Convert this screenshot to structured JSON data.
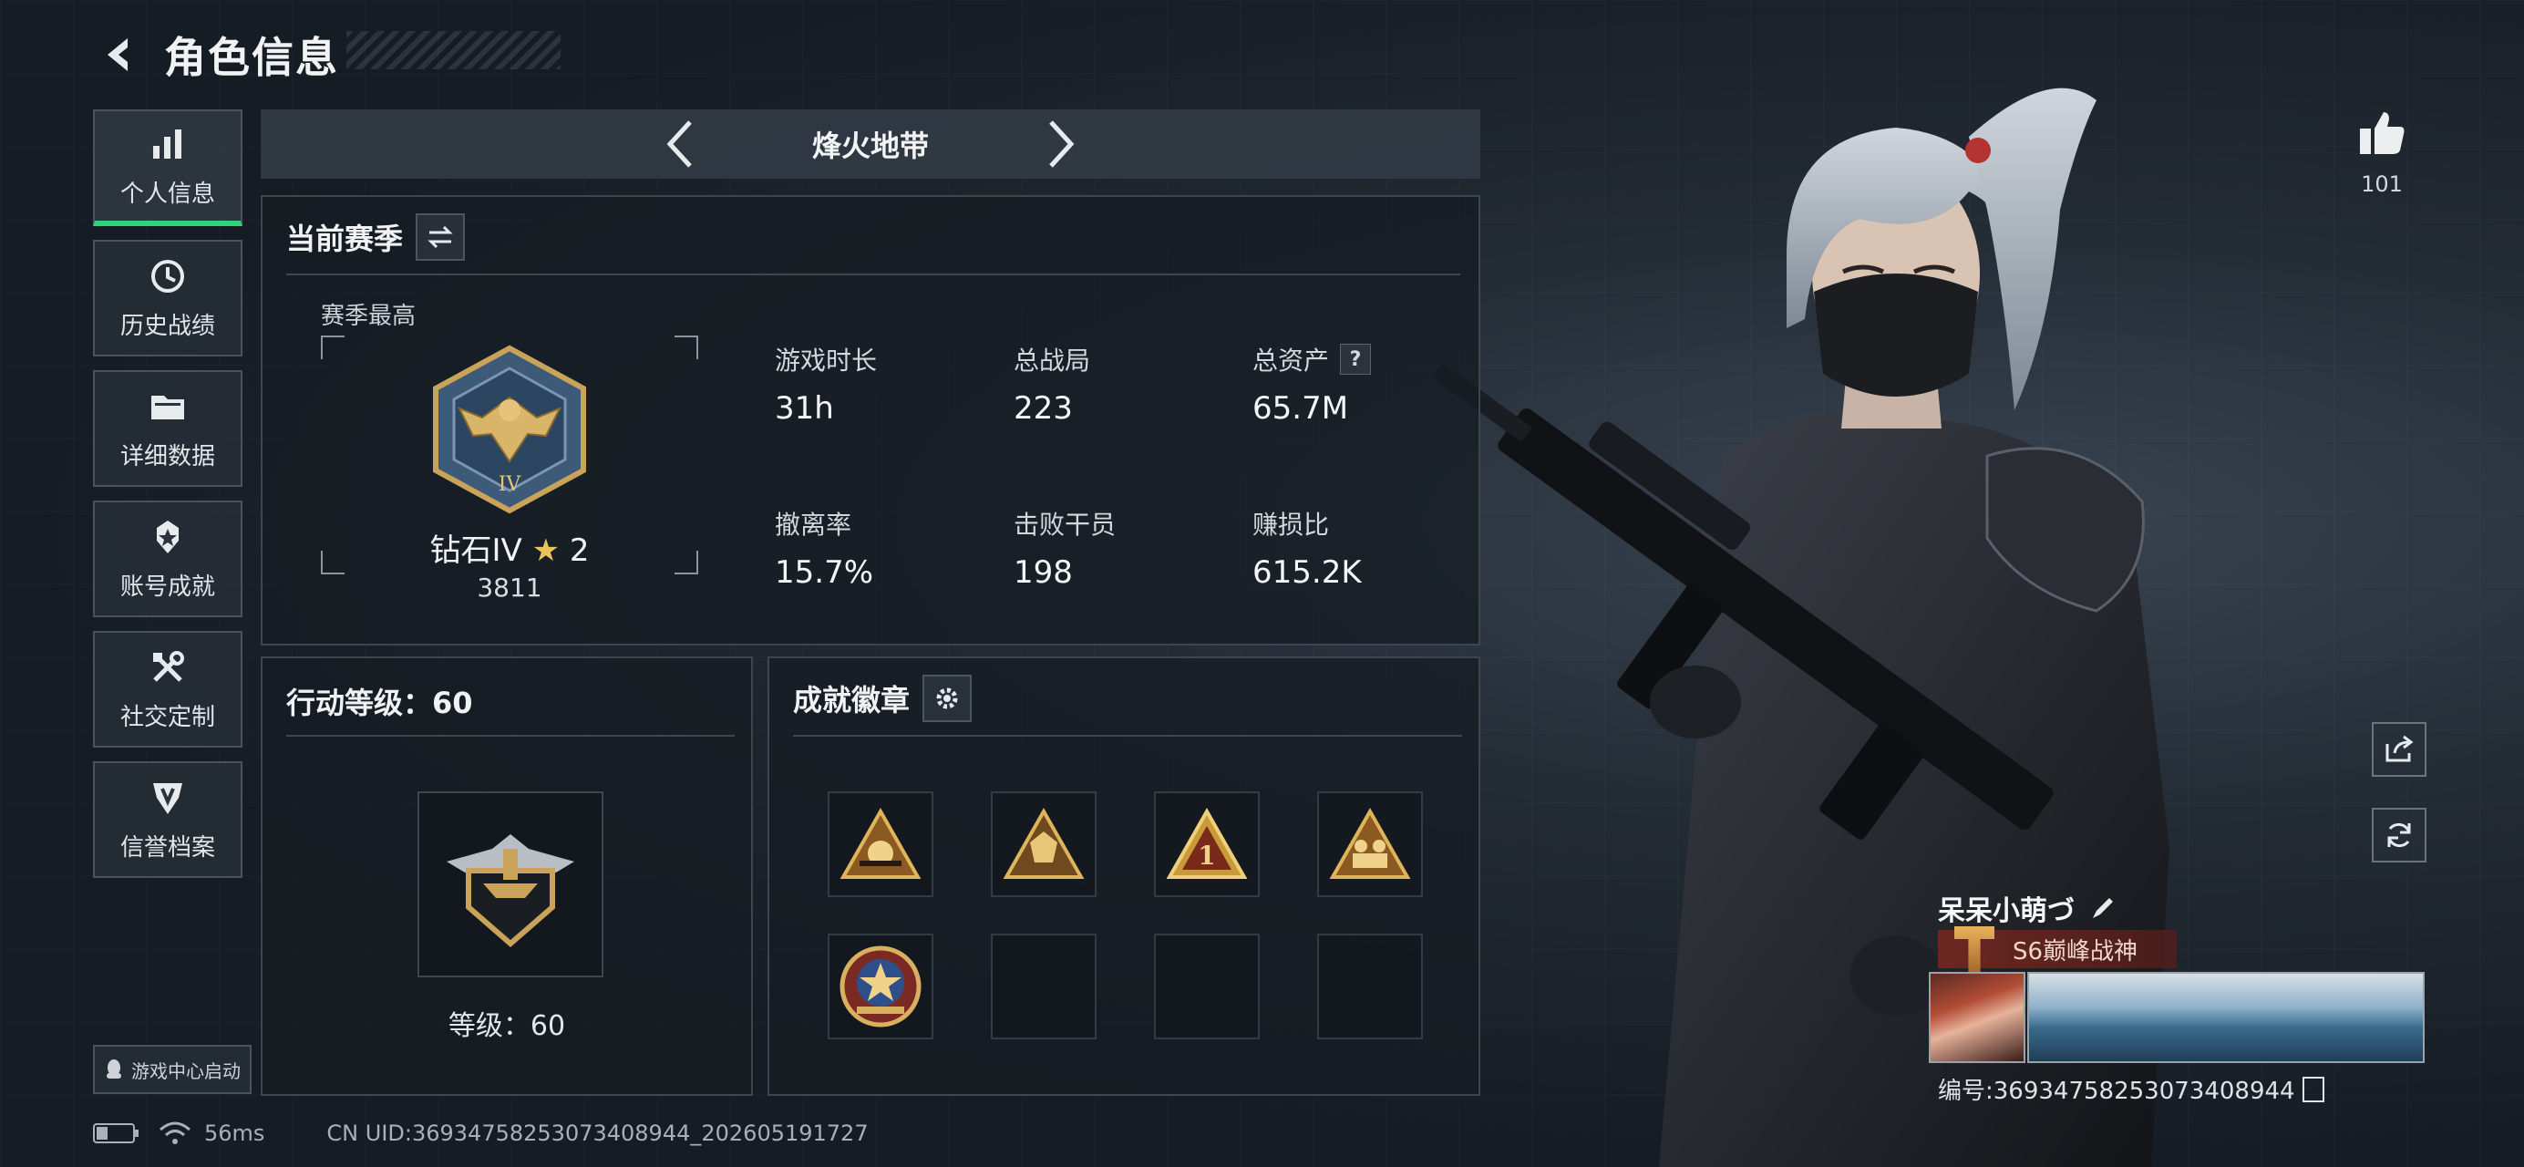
{
  "header": {
    "title": "角色信息"
  },
  "sidebar": {
    "items": [
      {
        "label": "个人信息",
        "icon": "bar-chart-icon",
        "active": true
      },
      {
        "label": "历史战绩",
        "icon": "clock-icon",
        "active": false
      },
      {
        "label": "详细数据",
        "icon": "folder-icon",
        "active": false
      },
      {
        "label": "账号成就",
        "icon": "medal-icon",
        "active": false
      },
      {
        "label": "社交定制",
        "icon": "tools-icon",
        "active": false
      },
      {
        "label": "信誉档案",
        "icon": "shield-icon",
        "active": false
      }
    ],
    "game_center_label": "游戏中心启动"
  },
  "mode": {
    "title": "烽火地带"
  },
  "season": {
    "header": "当前赛季",
    "peak_label": "赛季最高",
    "rank_name": "钻石IV",
    "rank_stars": "2",
    "rank_score": "3811",
    "badge_numeral": "IV"
  },
  "stats": [
    {
      "label": "游戏时长",
      "value": "31h"
    },
    {
      "label": "总战局",
      "value": "223"
    },
    {
      "label": "总资产",
      "value": "65.7M",
      "help": "?"
    },
    {
      "label": "撤离率",
      "value": "15.7%"
    },
    {
      "label": "击败干员",
      "value": "198"
    },
    {
      "label": "赚损比",
      "value": "615.2K"
    }
  ],
  "action_level": {
    "header": "行动等级：60",
    "caption": "等级：60"
  },
  "achievements": {
    "header": "成就徽章",
    "badges": [
      {
        "icon": "triangle-badge-sun-icon",
        "filled": true
      },
      {
        "icon": "triangle-badge-emblem-icon",
        "filled": true
      },
      {
        "icon": "triangle-badge-number-one-icon",
        "filled": true,
        "text": "1"
      },
      {
        "icon": "triangle-badge-squad-icon",
        "filled": true
      },
      {
        "icon": "round-star-badge-icon",
        "filled": true
      },
      {
        "icon": "empty-slot",
        "filled": false
      },
      {
        "icon": "empty-slot",
        "filled": false
      },
      {
        "icon": "empty-slot",
        "filled": false
      }
    ]
  },
  "status_bar": {
    "ping": "56ms",
    "uid": "CN UID:36934758253073408944_202605191727"
  },
  "profile": {
    "likes": "101",
    "player_name": "呆呆小萌づ",
    "title": "S6巅峰战神",
    "id_line": "编号:36934758253073408944"
  },
  "colors": {
    "accent_green": "#2fd37a",
    "gold": "#c9a35a",
    "panel_border": "#3d4650"
  }
}
